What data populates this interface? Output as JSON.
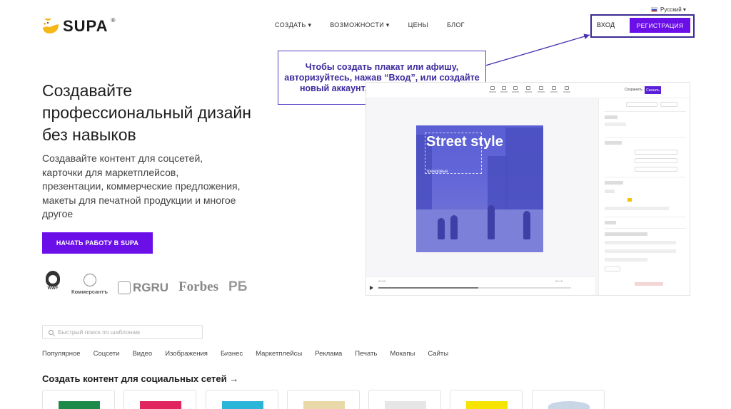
{
  "header": {
    "logo_text": "SUPA",
    "logo_reg": "®",
    "nav": [
      "СОЗДАТЬ ▾",
      "ВОЗМОЖНОСТИ ▾",
      "ЦЕНЫ",
      "БЛОГ"
    ],
    "language": "Русский ▾",
    "login_label": "ВХОД",
    "register_label": "РЕГИСТРАЦИЯ"
  },
  "callout": {
    "text": "Чтобы создать плакат или афишу, авторизуйтесь, нажав “Вход”, или создайте новый аккаунт, нажав “Регистрация”"
  },
  "hero": {
    "title": "Создавайте профессиональный дизайн без навыков",
    "subtitle": "Создавайте контент для соцсетей, карточки для маркетплейсов, презентации, коммерческие предложения, макеты для печатной продукции и многое другое",
    "cta_label": "НАЧАТЬ РАБОТУ В SUPA"
  },
  "partners": {
    "wwf": "WWF",
    "kommersant": "Коммерсантъ",
    "rgru": "RGRU",
    "forbes": "Forbes",
    "rbc": "РБ"
  },
  "editor": {
    "canvas_title": "Street style",
    "canvas_caption": "трендовые",
    "save_label": "Сохранить",
    "download_label": "Скачать"
  },
  "search": {
    "placeholder": "Быстрый поиск по шаблонам"
  },
  "categories": [
    "Популярное",
    "Соцсети",
    "Видео",
    "Изображения",
    "Бизнес",
    "Маркетплейсы",
    "Реклама",
    "Печать",
    "Мокапы",
    "Сайты"
  ],
  "section": {
    "title": "Создать контент для социальных сетей →"
  },
  "colors": {
    "accent": "#6b0fe8",
    "callout_border": "#5a3ec8",
    "callout_text": "#3b2a9d",
    "highlight_box": "#3a2a93",
    "canvas_bg": "#5a5fd4"
  }
}
